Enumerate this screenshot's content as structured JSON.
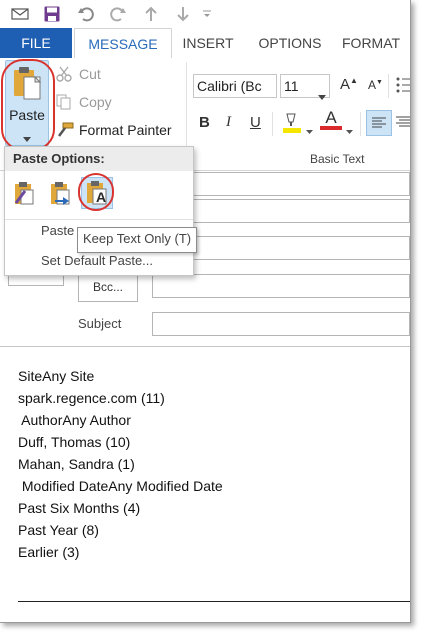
{
  "window": {
    "accent_color": "#1e5fb4",
    "highlight_circle_color": "#d9332e"
  },
  "quick_access": {
    "icons": [
      "save-icon",
      "undo-icon",
      "redo-icon",
      "up-arrow-icon",
      "down-arrow-icon",
      "customize-dropdown-icon"
    ]
  },
  "tabs": {
    "file": "FILE",
    "message": "MESSAGE",
    "insert": "INSERT",
    "options": "OPTIONS",
    "format": "FORMAT"
  },
  "ribbon": {
    "paste_label": "Paste",
    "cut_label": "Cut",
    "copy_label": "Copy",
    "format_painter_label": "Format Painter",
    "font_name": "Calibri (Bc",
    "font_size": "11",
    "group_basic_text": "Basic Text",
    "grow_font": "A",
    "shrink_font": "A",
    "bold": "B",
    "italic": "I",
    "underline": "U",
    "highlight_color": "#f5e600",
    "font_color_letter": "A",
    "font_color": "#d92b2b"
  },
  "paste_menu": {
    "header": "Paste Options:",
    "options": [
      "keep-source-formatting-icon",
      "merge-formatting-icon",
      "keep-text-only-icon"
    ],
    "keep_text_letter": "A",
    "item_paste_special": "Paste",
    "item_set_default": "Set Default Paste...",
    "tooltip": "Keep Text Only (T)"
  },
  "compose": {
    "bcc_label": "Bcc...",
    "subject_label": "Subject",
    "subject_value": ""
  },
  "body": {
    "lines": [
      "SiteAny Site",
      "spark.regence.com (11)",
      " AuthorAny Author",
      "Duff, Thomas (10)",
      "Mahan, Sandra (1)",
      " Modified DateAny Modified Date",
      "Past Six Months (4)",
      "Past Year (8)",
      "Earlier (3)"
    ]
  }
}
